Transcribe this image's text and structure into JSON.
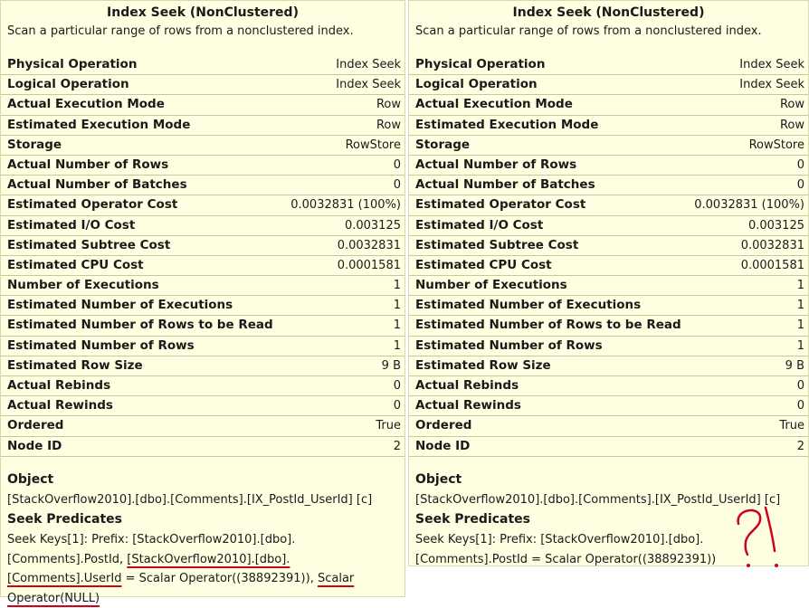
{
  "left": {
    "title": "Index Seek (NonClustered)",
    "description": "Scan a particular range of rows from a nonclustered index.",
    "properties": [
      {
        "label": "Physical Operation",
        "value": "Index Seek"
      },
      {
        "label": "Logical Operation",
        "value": "Index Seek"
      },
      {
        "label": "Actual Execution Mode",
        "value": "Row"
      },
      {
        "label": "Estimated Execution Mode",
        "value": "Row"
      },
      {
        "label": "Storage",
        "value": "RowStore"
      },
      {
        "label": "Actual Number of Rows",
        "value": "0"
      },
      {
        "label": "Actual Number of Batches",
        "value": "0"
      },
      {
        "label": "Estimated Operator Cost",
        "value": "0.0032831 (100%)"
      },
      {
        "label": "Estimated I/O Cost",
        "value": "0.003125"
      },
      {
        "label": "Estimated Subtree Cost",
        "value": "0.0032831"
      },
      {
        "label": "Estimated CPU Cost",
        "value": "0.0001581"
      },
      {
        "label": "Number of Executions",
        "value": "1"
      },
      {
        "label": "Estimated Number of Executions",
        "value": "1"
      },
      {
        "label": "Estimated Number of Rows to be Read",
        "value": "1"
      },
      {
        "label": "Estimated Number of Rows",
        "value": "1"
      },
      {
        "label": "Estimated Row Size",
        "value": "9 B"
      },
      {
        "label": "Actual Rebinds",
        "value": "0"
      },
      {
        "label": "Actual Rewinds",
        "value": "0"
      },
      {
        "label": "Ordered",
        "value": "True"
      },
      {
        "label": "Node ID",
        "value": "2"
      }
    ],
    "object_heading": "Object",
    "object_value": "[StackOverflow2010].[dbo].[Comments].[IX_PostId_UserId] [c]",
    "seek_heading": "Seek Predicates",
    "seek_parts": [
      "Seek Keys[1]: Prefix: [StackOverflow2010].[dbo].",
      "[Comments].PostId, ",
      "[StackOverflow2010].[dbo].",
      "[Comments].UserId",
      " = Scalar Operator((38892391)), ",
      "Scalar",
      "Operator(NULL)"
    ]
  },
  "right": {
    "title": "Index Seek (NonClustered)",
    "description": "Scan a particular range of rows from a nonclustered index.",
    "properties": [
      {
        "label": "Physical Operation",
        "value": "Index Seek"
      },
      {
        "label": "Logical Operation",
        "value": "Index Seek"
      },
      {
        "label": "Actual Execution Mode",
        "value": "Row"
      },
      {
        "label": "Estimated Execution Mode",
        "value": "Row"
      },
      {
        "label": "Storage",
        "value": "RowStore"
      },
      {
        "label": "Actual Number of Rows",
        "value": "0"
      },
      {
        "label": "Actual Number of Batches",
        "value": "0"
      },
      {
        "label": "Estimated Operator Cost",
        "value": "0.0032831 (100%)"
      },
      {
        "label": "Estimated I/O Cost",
        "value": "0.003125"
      },
      {
        "label": "Estimated Subtree Cost",
        "value": "0.0032831"
      },
      {
        "label": "Estimated CPU Cost",
        "value": "0.0001581"
      },
      {
        "label": "Number of Executions",
        "value": "1"
      },
      {
        "label": "Estimated Number of Executions",
        "value": "1"
      },
      {
        "label": "Estimated Number of Rows to be Read",
        "value": "1"
      },
      {
        "label": "Estimated Number of Rows",
        "value": "1"
      },
      {
        "label": "Estimated Row Size",
        "value": "9 B"
      },
      {
        "label": "Actual Rebinds",
        "value": "0"
      },
      {
        "label": "Actual Rewinds",
        "value": "0"
      },
      {
        "label": "Ordered",
        "value": "True"
      },
      {
        "label": "Node ID",
        "value": "2"
      }
    ],
    "object_heading": "Object",
    "object_value": "[StackOverflow2010].[dbo].[Comments].[IX_PostId_UserId] [c]",
    "seek_heading": "Seek Predicates",
    "seek_line1": "Seek Keys[1]: Prefix: [StackOverflow2010].[dbo].",
    "seek_line2": "[Comments].PostId = Scalar Operator((38892391))"
  },
  "annotation": {
    "color": "#d0021b",
    "mark": "?!"
  }
}
